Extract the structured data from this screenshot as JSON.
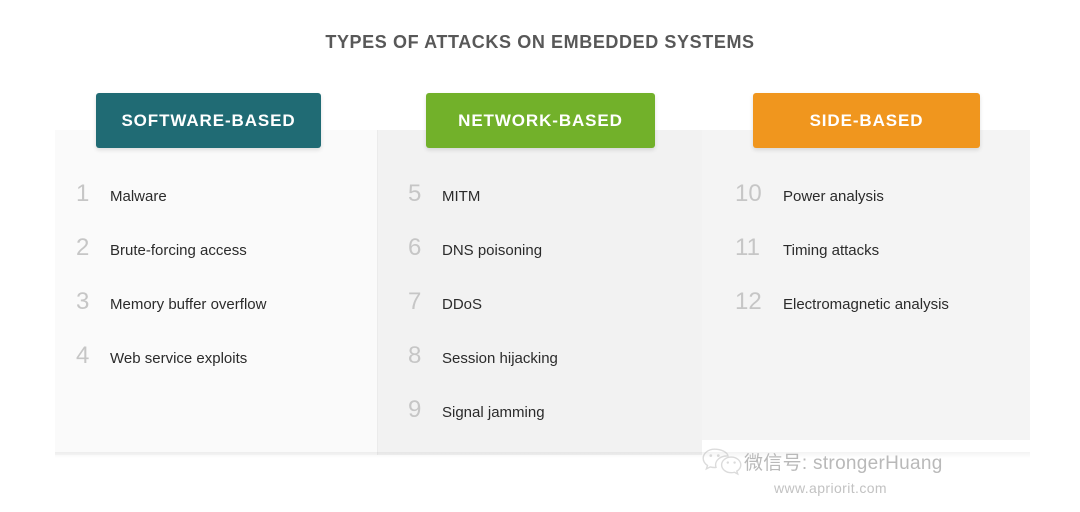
{
  "title": "TYPES OF ATTACKS ON EMBEDDED SYSTEMS",
  "columns": [
    {
      "header": "SOFTWARE-BASED",
      "color": "#206b74",
      "items": [
        {
          "num": "1",
          "label": "Malware"
        },
        {
          "num": "2",
          "label": "Brute-forcing access"
        },
        {
          "num": "3",
          "label": "Memory buffer overflow"
        },
        {
          "num": "4",
          "label": "Web service exploits"
        }
      ]
    },
    {
      "header": "NETWORK-BASED",
      "color": "#72b12a",
      "items": [
        {
          "num": "5",
          "label": "MITM"
        },
        {
          "num": "6",
          "label": "DNS poisoning"
        },
        {
          "num": "7",
          "label": "DDoS"
        },
        {
          "num": "8",
          "label": "Session hijacking"
        },
        {
          "num": "9",
          "label": "Signal jamming"
        }
      ]
    },
    {
      "header": "SIDE-BASED",
      "color": "#f0961e",
      "items": [
        {
          "num": "10",
          "label": "Power analysis"
        },
        {
          "num": "11",
          "label": "Timing attacks"
        },
        {
          "num": "12",
          "label": "Electromagnetic analysis"
        }
      ]
    }
  ],
  "watermark": {
    "icon": "wechat-icon",
    "handle": "微信号: strongerHuang",
    "url": "www.apriorit.com"
  },
  "colors": {
    "title_text": "#585858",
    "item_text": "#2b2b2b",
    "item_number": "#c6c6c6",
    "panel_light": "#fafafa",
    "panel_gray": "#f2f2f2",
    "page_background": "#ffffff"
  }
}
